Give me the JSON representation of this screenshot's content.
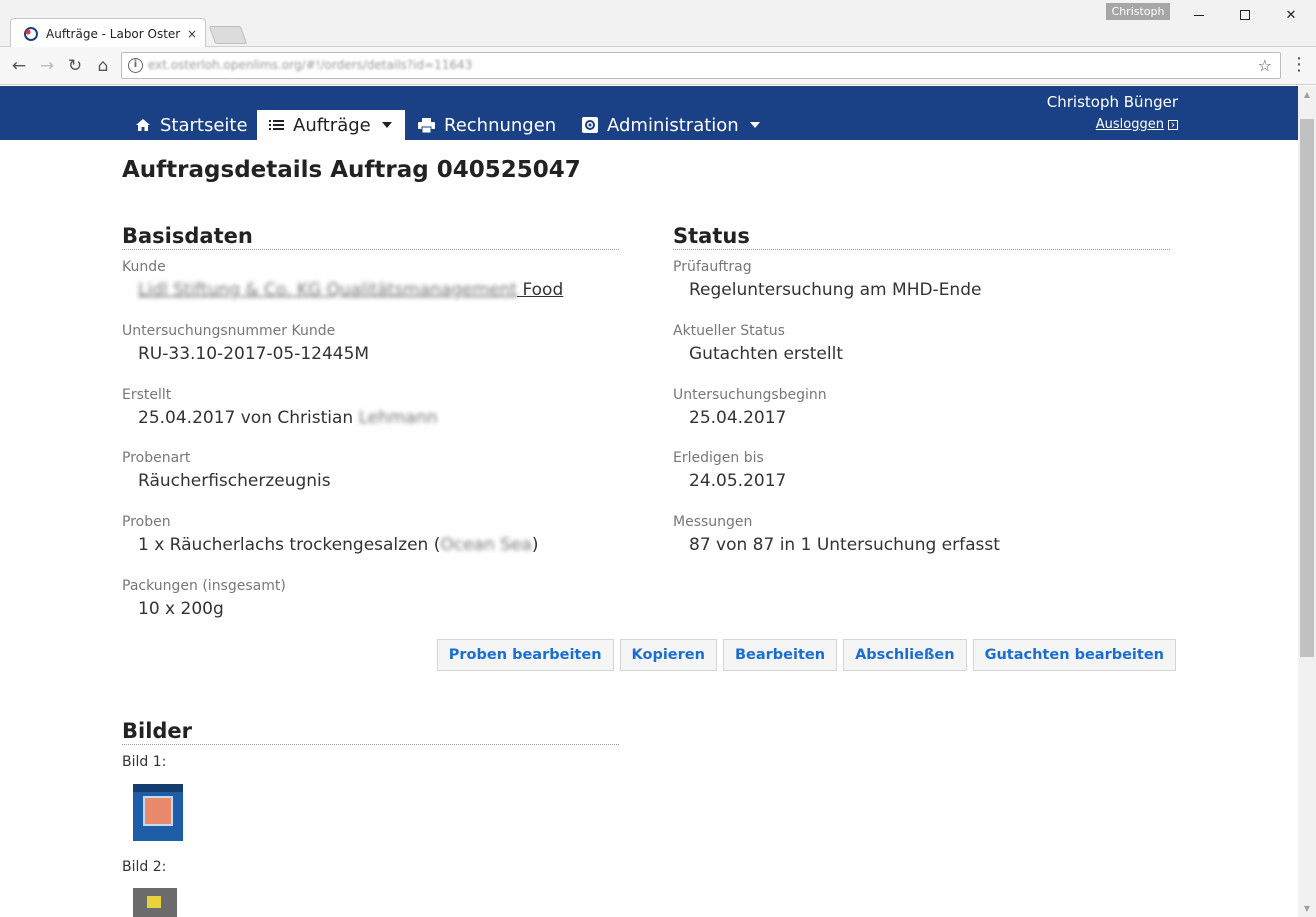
{
  "browser": {
    "tab_title": "Aufträge - Labor Osterloh",
    "tab_close": "×",
    "profile_name": "Christoph",
    "minimize": "—",
    "maximize": "☐",
    "close": "✕",
    "back": "←",
    "forward": "→",
    "reload": "↻",
    "home": "⌂",
    "info": "i",
    "url": "ext.osterloh.openlims.org/#!/orders/details?id=11643",
    "bookmark": "☆",
    "menu": "⋮"
  },
  "appnav": {
    "items": [
      {
        "label": "Startseite",
        "icon": "home-icon"
      },
      {
        "label": "Aufträge",
        "icon": "list-icon",
        "active": true,
        "dropdown": true
      },
      {
        "label": "Rechnungen",
        "icon": "printer-icon"
      },
      {
        "label": "Administration",
        "icon": "settings-icon",
        "dropdown": true
      }
    ],
    "user_name": "Christoph Bünger",
    "logout_label": "Ausloggen"
  },
  "page": {
    "title": "Auftragsdetails Auftrag 040525047"
  },
  "basisdaten": {
    "heading": "Basisdaten",
    "kunde_label": "Kunde",
    "kunde_value_blurred": "Lidl Stiftung & Co. KG Qualitätsmanagement",
    "kunde_value_clear": "Food",
    "untersuchungsnummer_label": "Untersuchungsnummer Kunde",
    "untersuchungsnummer_value": "RU-33.10-2017-05-12445M",
    "erstellt_label": "Erstellt",
    "erstellt_value": "25.04.2017 von Christian",
    "erstellt_value_blurred": "Lehmann",
    "probenart_label": "Probenart",
    "probenart_value": "Räucherfischerzeugnis",
    "proben_label": "Proben",
    "proben_value": "1 x Räucherlachs trockengesalzen (",
    "proben_value_blurred": "Ocean Sea",
    "proben_value_end": ")",
    "packungen_label": "Packungen (insgesamt)",
    "packungen_value": "10 x 200g"
  },
  "status": {
    "heading": "Status",
    "pruefauftrag_label": "Prüfauftrag",
    "pruefauftrag_value": "Regeluntersuchung am MHD-Ende",
    "aktueller_status_label": "Aktueller Status",
    "aktueller_status_value": "Gutachten erstellt",
    "untersuchungsbeginn_label": "Untersuchungsbeginn",
    "untersuchungsbeginn_value": "25.04.2017",
    "erledigen_label": "Erledigen bis",
    "erledigen_value": "24.05.2017",
    "messungen_label": "Messungen",
    "messungen_value": "87 von 87 in 1 Untersuchung erfasst"
  },
  "actions": {
    "proben_bearbeiten": "Proben bearbeiten",
    "kopieren": "Kopieren",
    "bearbeiten": "Bearbeiten",
    "abschliessen": "Abschließen",
    "gutachten_bearbeiten": "Gutachten bearbeiten"
  },
  "bilder": {
    "heading": "Bilder",
    "bild1_label": "Bild 1:",
    "bild2_label": "Bild 2:"
  },
  "colors": {
    "navbar": "#1a4185",
    "action_text": "#1a6ed1"
  }
}
